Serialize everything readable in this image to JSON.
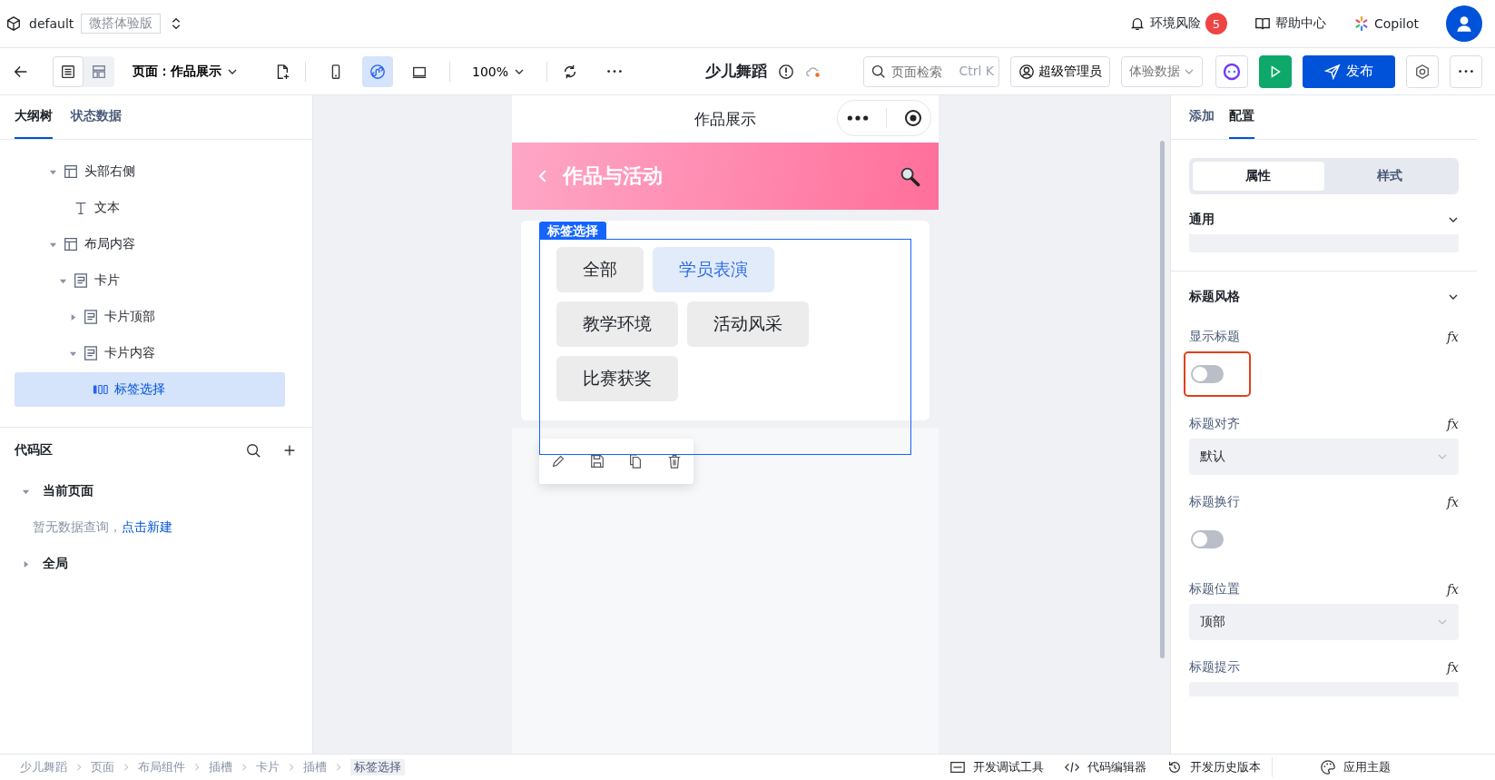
{
  "app": {
    "workspace": "default",
    "edition": "微搭体验版",
    "notice": {
      "label": "环境风险",
      "count": "5"
    },
    "help": "帮助中心",
    "copilot": "Copilot"
  },
  "toolbar": {
    "page": "页面：作品展示",
    "zoom": "100%",
    "app_name": "少儿舞蹈",
    "search": {
      "placeholder": "页面检索",
      "shortcut": "Ctrl K"
    },
    "role": "超级管理员",
    "data_source": "体验数据",
    "publish": "发布",
    "devices": [
      {
        "kind": "phone",
        "selected": false
      },
      {
        "kind": "miniapp",
        "selected": true
      },
      {
        "kind": "desktop",
        "selected": false
      }
    ]
  },
  "left": {
    "tabs": [
      {
        "label": "大纲树",
        "selected": true
      },
      {
        "label": "状态数据",
        "selected": false
      }
    ],
    "tree": [
      {
        "label": "头部右侧",
        "kind": "layout",
        "expanded": true,
        "selected": false,
        "children": [
          {
            "label": "文本",
            "kind": "text",
            "selected": false
          }
        ]
      },
      {
        "label": "布局内容",
        "kind": "layout",
        "expanded": true,
        "selected": false,
        "children": [
          {
            "label": "卡片",
            "kind": "card",
            "expanded": true,
            "selected": false,
            "children": [
              {
                "label": "卡片顶部",
                "kind": "card",
                "expanded": false,
                "selected": false
              },
              {
                "label": "卡片内容",
                "kind": "card",
                "expanded": true,
                "selected": false,
                "children": [
                  {
                    "label": "标签选择",
                    "kind": "tags",
                    "selected": true
                  }
                ]
              }
            ]
          }
        ]
      }
    ],
    "code": {
      "title": "代码区",
      "groups": [
        {
          "label": "当前页面",
          "expanded": true,
          "empty": "暂无数据查询，",
          "link": "点击新建"
        },
        {
          "label": "全局",
          "expanded": false
        }
      ]
    }
  },
  "preview": {
    "mp_title": "作品展示",
    "header": "作品与活动",
    "component_label": "标签选择",
    "tags": [
      {
        "label": "全部",
        "selected": false
      },
      {
        "label": "学员表演",
        "selected": true
      },
      {
        "label": "教学环境",
        "selected": false
      },
      {
        "label": "活动风采",
        "selected": false
      },
      {
        "label": "比赛获奖",
        "selected": false
      }
    ]
  },
  "right": {
    "tabs": [
      {
        "label": "添加",
        "selected": false
      },
      {
        "label": "配置",
        "selected": true
      }
    ],
    "segments": [
      {
        "label": "属性",
        "selected": true
      },
      {
        "label": "样式",
        "selected": false
      }
    ],
    "sections": [
      {
        "title": "通用",
        "expanded": true
      },
      {
        "title": "标题风格",
        "expanded": true
      }
    ],
    "props": [
      {
        "label": "显示标题",
        "formula": "fx",
        "kind": "switch",
        "on": false,
        "highlighted": true
      },
      {
        "label": "标题对齐",
        "formula": "fx",
        "kind": "select",
        "value": "默认"
      },
      {
        "label": "标题换行",
        "formula": "fx",
        "kind": "switch",
        "on": false,
        "highlighted": false
      },
      {
        "label": "标题位置",
        "formula": "fx",
        "kind": "select",
        "value": "顶部"
      },
      {
        "label": "标题提示",
        "formula": "fx",
        "kind": "input"
      }
    ]
  },
  "status_bar": {
    "breadcrumb": [
      "少儿舞蹈",
      "页面",
      "布局组件",
      "插槽",
      "卡片",
      "插槽",
      "标签选择"
    ],
    "tools": [
      "开发调试工具",
      "代码编辑器",
      "开发历史版本"
    ],
    "theme": "应用主题"
  }
}
